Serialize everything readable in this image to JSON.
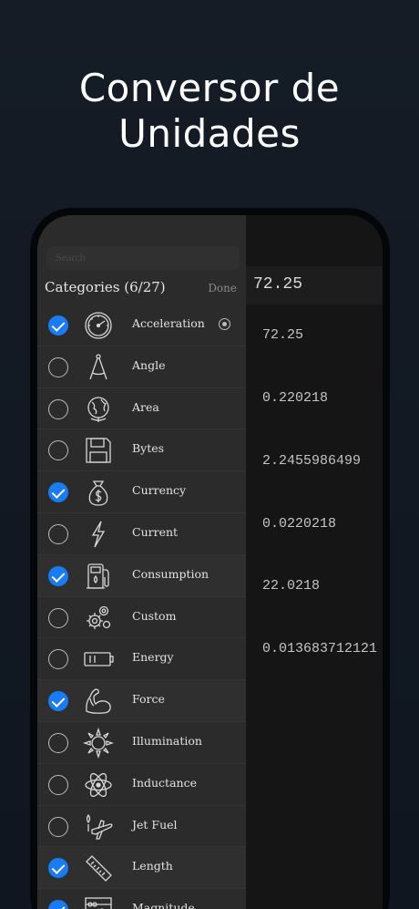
{
  "headline": {
    "line1": "Conversor de",
    "line2": "Unidades"
  },
  "categories": {
    "title": "Categories (6/27)",
    "done_label": "Done",
    "search_placeholder": "Search",
    "items": [
      {
        "label": "Acceleration",
        "checked": true,
        "icon": "speedometer-icon"
      },
      {
        "label": "Angle",
        "checked": false,
        "icon": "compass-drawing-icon"
      },
      {
        "label": "Area",
        "checked": false,
        "icon": "globe-icon"
      },
      {
        "label": "Bytes",
        "checked": false,
        "icon": "floppy-disk-icon"
      },
      {
        "label": "Currency",
        "checked": true,
        "icon": "money-bag-icon"
      },
      {
        "label": "Current",
        "checked": false,
        "icon": "lightning-icon"
      },
      {
        "label": "Consumption",
        "checked": true,
        "icon": "fuel-pump-icon"
      },
      {
        "label": "Custom",
        "checked": false,
        "icon": "gears-icon"
      },
      {
        "label": "Energy",
        "checked": false,
        "icon": "battery-icon"
      },
      {
        "label": "Force",
        "checked": true,
        "icon": "flexed-arm-icon"
      },
      {
        "label": "Illumination",
        "checked": false,
        "icon": "sun-icon"
      },
      {
        "label": "Inductance",
        "checked": false,
        "icon": "atom-icon"
      },
      {
        "label": "Jet Fuel",
        "checked": false,
        "icon": "airplane-icon"
      },
      {
        "label": "Length",
        "checked": true,
        "icon": "ruler-icon"
      },
      {
        "label": "Magnitude",
        "checked": true,
        "icon": "abacus-icon"
      }
    ]
  },
  "converter": {
    "input_value": "72.25",
    "results": [
      "72.25",
      "0.220218",
      "2.2455986499",
      "0.0220218",
      "22.0218",
      "0.013683712121"
    ]
  },
  "colors": {
    "accent": "#1a7cf5",
    "background": "#121922"
  }
}
